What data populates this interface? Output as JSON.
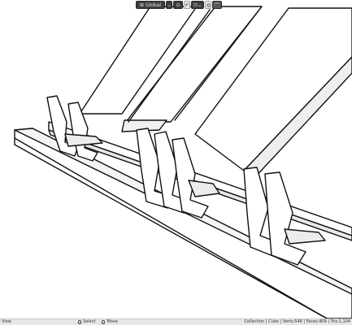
{
  "header": {
    "orientation_label": "Global",
    "icons": [
      "transform-orientation-icon",
      "pivot-icon",
      "snap-icon",
      "snap-target-icon",
      "proportional-edit-icon",
      "falloff-icon"
    ]
  },
  "statusbar": {
    "left": "View",
    "select_label": "Select",
    "move_label": "Move",
    "info": "Collection | Cube | Verts:548 | Faces:409 | Tris:1,104"
  },
  "colors": {
    "background": "#ffffff",
    "line": "#111111",
    "shade": "#e9e9e9",
    "header_button": "#3d3d3d",
    "statusbar": "#e6e6e6"
  }
}
